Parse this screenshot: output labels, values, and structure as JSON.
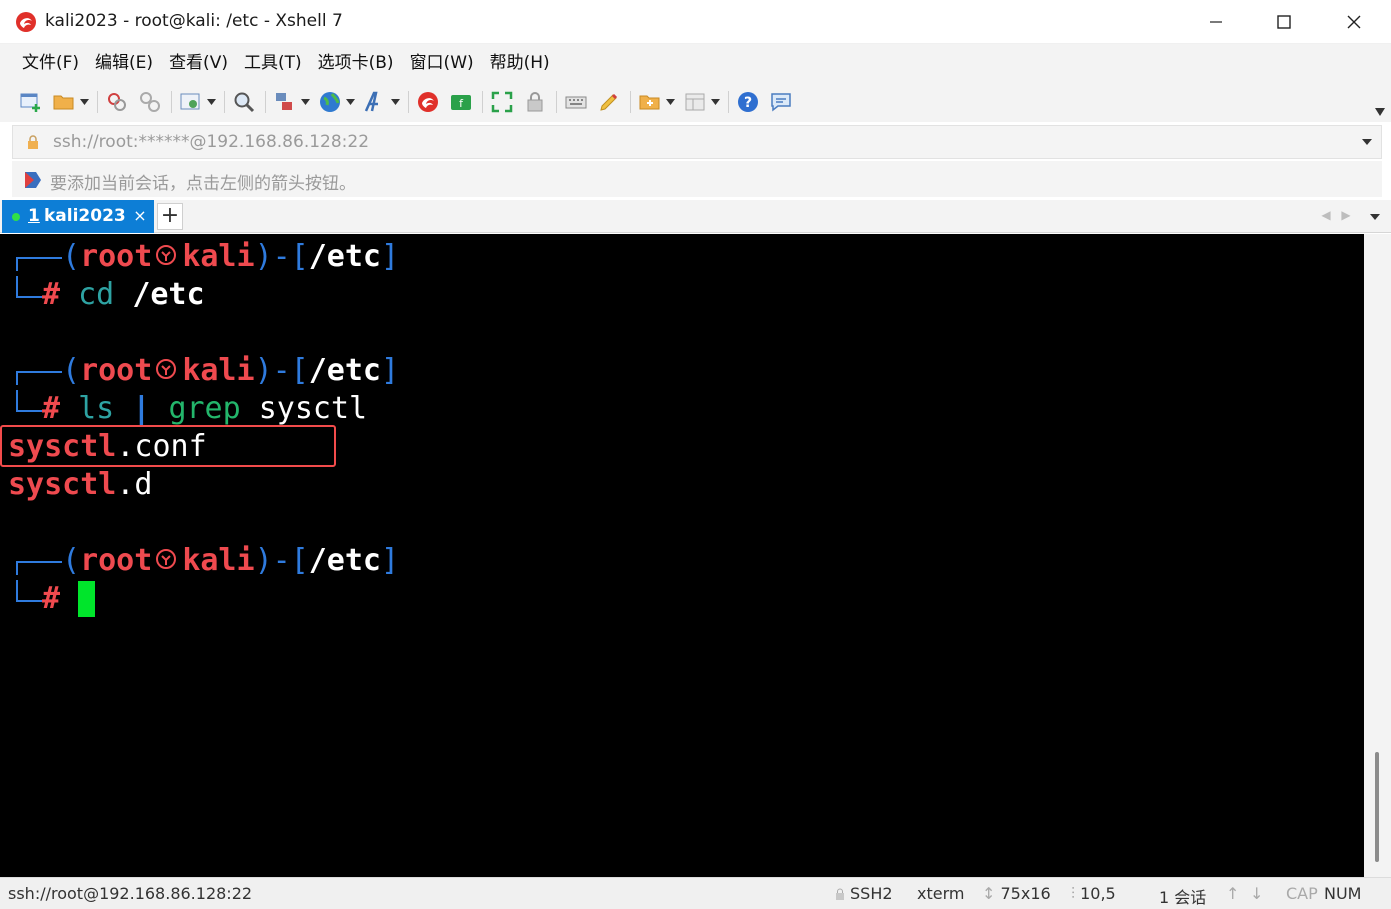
{
  "window": {
    "title": "kali2023 - root@kali: /etc - Xshell 7",
    "minimize_icon": "minimize-icon",
    "maximize_icon": "maximize-icon",
    "close_icon": "close-icon"
  },
  "menu": [
    "文件(F)",
    "编辑(E)",
    "查看(V)",
    "工具(T)",
    "选项卡(B)",
    "窗口(W)",
    "帮助(H)"
  ],
  "toolbar": {
    "icons": [
      "new-session-icon",
      "open-folder-icon",
      "reconnect-icon",
      "disconnect-icon",
      "properties-icon",
      "find-icon",
      "transfer-icon",
      "globe-icon",
      "font-icon",
      "xshell-icon",
      "xftp-icon",
      "fullscreen-icon",
      "lock-icon",
      "keyboard-icon",
      "highlight-icon",
      "add-folder-icon",
      "layout-icon",
      "help-icon",
      "chat-icon"
    ]
  },
  "address": {
    "value": "ssh://root:******@192.168.86.128:22"
  },
  "hint": {
    "text": "要添加当前会话，点击左侧的箭头按钮。"
  },
  "tabs": {
    "active": {
      "number": "1",
      "label": "kali2023",
      "close": "×"
    },
    "add": "+"
  },
  "terminal": {
    "prompt_open": "(",
    "prompt_user": "root",
    "prompt_host": "kali",
    "prompt_mid": ")-[",
    "prompt_path": "/etc",
    "prompt_close": "]",
    "hash": "#",
    "cmd1": "cd /etc",
    "cmd1_a": "cd",
    "cmd1_b": "/etc",
    "cmd2_a": "ls",
    "cmd2_pipe": "|",
    "cmd2_b": "grep",
    "cmd2_c": "sysctl",
    "out1_a": "sysctl",
    "out1_b": ".conf",
    "out2_a": "sysctl",
    "out2_b": ".d",
    "colors": {
      "background": "#000000",
      "prompt_line": "#2f7bde",
      "user": "#ef4a4f",
      "cursor": "#00e52b",
      "highlight_box": "#f24b4b"
    }
  },
  "status": {
    "connection": "ssh://root@192.168.86.128:22",
    "protocol": "SSH2",
    "term": "xterm",
    "size": "75x16",
    "cursor_pos": "10,5",
    "sessions": "1 会话",
    "cap": "CAP",
    "num": "NUM"
  }
}
